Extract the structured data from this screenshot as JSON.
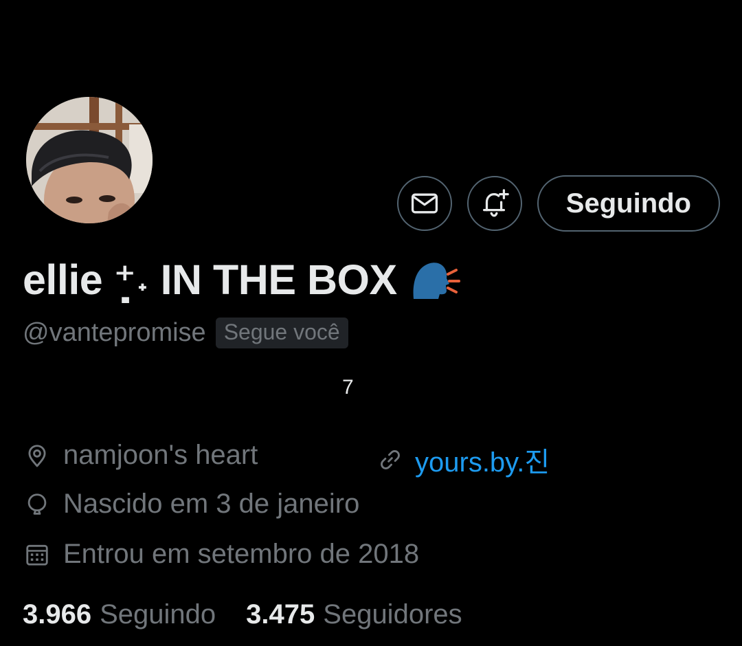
{
  "profile": {
    "display_name": "ellie ⁺̣˖ IN THE BOX",
    "name_emoji": "speaking-head-emoji",
    "handle": "@vantepromise",
    "follows_you_label": "Segue você",
    "bio": "7",
    "location": "namjoon's heart",
    "website": "yours.by.진",
    "birthday": "Nascido em 3 de janeiro",
    "joined": "Entrou em setembro de 2018"
  },
  "actions": {
    "message_icon": "envelope-icon",
    "notify_icon": "bell-plus-icon",
    "follow_label": "Seguindo"
  },
  "stats": {
    "following_count": "3.966",
    "following_label": "Seguindo",
    "followers_count": "3.475",
    "followers_label": "Seguidores"
  },
  "colors": {
    "background": "#000000",
    "text_primary": "#e7e9ea",
    "text_secondary": "#71767b",
    "border": "#536471",
    "link": "#1d9bf0",
    "badge_bg": "#202327"
  }
}
